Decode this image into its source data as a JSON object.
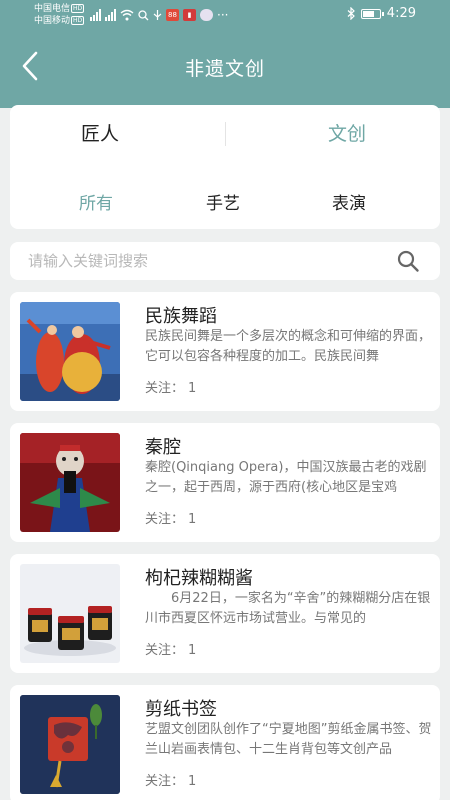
{
  "status_bar": {
    "carrier1": "中国电信",
    "carrier2": "中国移动",
    "hd": "HD",
    "time": "4:29"
  },
  "header": {
    "title": "非遗文创"
  },
  "tabs": {
    "main": [
      "匠人",
      "文创"
    ],
    "active_main": "文创",
    "sub": [
      "所有",
      "手艺",
      "表演"
    ],
    "active_sub": "所有"
  },
  "search": {
    "placeholder": "请输入关键词搜索",
    "value": ""
  },
  "items": [
    {
      "title": "民族舞蹈",
      "desc": "民族民间舞是一个多层次的概念和可伸缩的界面，它可以包容各种程度的加工。民族民间舞",
      "follow_label": "关注：",
      "follow_count": "1"
    },
    {
      "title": "秦腔",
      "desc": "秦腔(Qinqiang Opera)，中国汉族最古老的戏剧之一，起于西周，源于西府(核心地区是宝鸡",
      "follow_label": "关注：",
      "follow_count": "1"
    },
    {
      "title": "枸杞辣糊糊酱",
      "desc": "　　6月22日，一家名为“辛舍”的辣糊糊分店在银川市西夏区怀远市场试营业。与常见的",
      "follow_label": "关注：",
      "follow_count": "1"
    },
    {
      "title": "剪纸书签",
      "desc": "艺盟文创团队创作了“宁夏地图”剪纸金属书签、贺兰山岩画表情包、十二生肖背包等文创产品",
      "follow_label": "关注：",
      "follow_count": "1"
    }
  ],
  "colors": {
    "accent": "#6fa7a5",
    "background": "#eef0f0",
    "text_primary": "#222222",
    "text_secondary": "#777777"
  }
}
